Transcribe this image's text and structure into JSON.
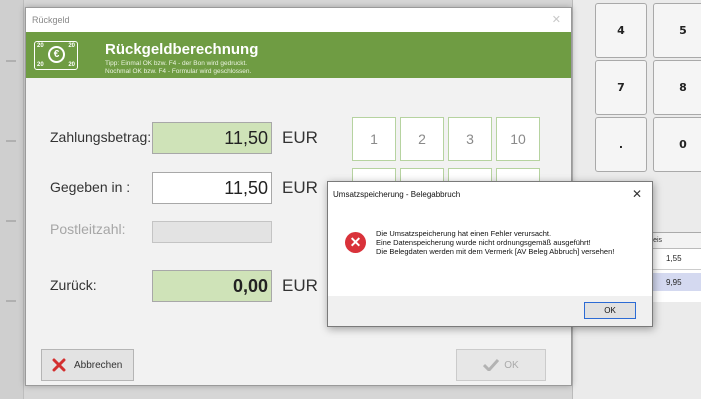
{
  "background": {
    "keypad_keys": [
      "4",
      "5",
      "7",
      "8",
      ".",
      "0"
    ],
    "table": {
      "header_partial": "nzelpreis",
      "prices": [
        "1,55",
        "9,95"
      ]
    }
  },
  "dialog": {
    "title": "Rückgeld",
    "header": {
      "icon_numbers": [
        "20",
        "20",
        "20",
        "20"
      ],
      "icon_symbol": "€",
      "title": "Rückgeldberechnung",
      "tip_line1": "Tipp: Einmal OK bzw. F4 - der Bon wird gedruckt.",
      "tip_line2": "Nochmal OK bzw. F4 - Formular wird geschlossen."
    },
    "fields": {
      "payment_label": "Zahlungsbetrag:",
      "payment_value": "11,50",
      "given_label": "Gegeben in :",
      "given_value": "11,50",
      "postcode_label": "Postleitzahl:",
      "postcode_value": "",
      "change_label": "Zurück:",
      "change_value": "0,00",
      "currency": "EUR"
    },
    "quick_amounts": [
      "1",
      "2",
      "3",
      "10"
    ],
    "buttons": {
      "cancel_label": "Abbrechen",
      "ok_label": "OK"
    },
    "colors": {
      "header_green": "#6f9c43",
      "field_green": "#cfe3b8",
      "cancel_red": "#d32f2f"
    }
  },
  "error_box": {
    "title": "Umsatzspeicherung - Belegabbruch",
    "line1": "Die Umsatzspeicherung  hat einen Fehler verursacht.",
    "line2": "Eine Datenspeicherung wurde nicht ordnungsgemäß ausgeführt!",
    "line3": "Die Belegdaten werden mit dem Vermerk [AV Beleg Abbruch] versehen!",
    "ok_label": "OK",
    "icon": "error-x-icon"
  }
}
